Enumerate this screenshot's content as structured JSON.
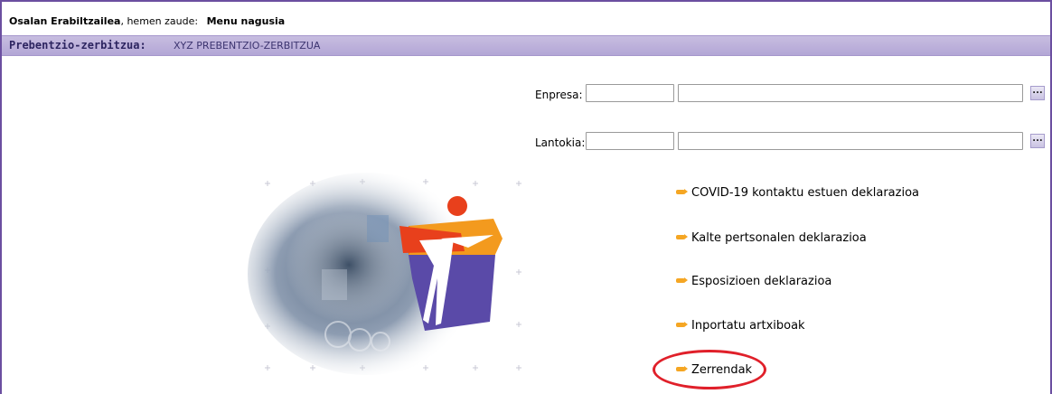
{
  "header": {
    "user_name": "Osalan Erabiltzailea",
    "location_text": ", hemen zaude:",
    "menu_label": "Menu nagusia"
  },
  "service_bar": {
    "label": "Prebentzio-zerbitzua:",
    "value": "XYZ PREBENTZIO-ZERBITZUA"
  },
  "filters": {
    "company_label": "Enpresa:",
    "company_code": "",
    "company_name": "",
    "workplace_label": "Lantokia:",
    "workplace_code": "",
    "workplace_name": "",
    "lookup_label": "..."
  },
  "menu_links": [
    {
      "label": "COVID-19 kontaktu estuen deklarazioa"
    },
    {
      "label": "Kalte pertsonalen deklarazioa"
    },
    {
      "label": "Esposizioen deklarazioa"
    },
    {
      "label": "Inportatu artxiboak"
    },
    {
      "label": "Zerrendak"
    }
  ],
  "colors": {
    "brand_purple": "#6b4fa0",
    "band_purple": "#b3a6d6",
    "bullet_orange": "#f5a623",
    "highlight_red": "#e0202a"
  },
  "icons": {
    "lookup": "ellipsis-icon",
    "bullet": "arrow-bullet-icon"
  }
}
